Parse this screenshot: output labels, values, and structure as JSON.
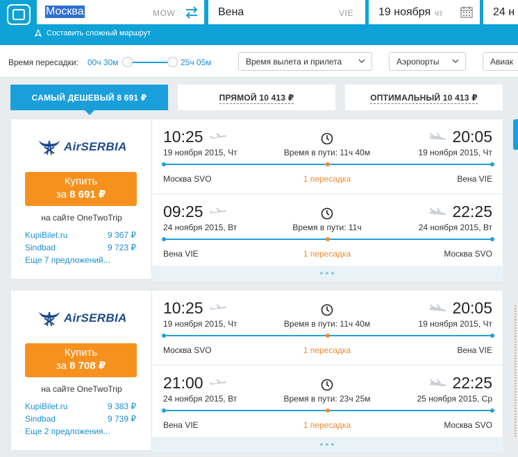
{
  "search": {
    "from_city": "Москва",
    "from_code": "MOW",
    "to_city": "Вена",
    "to_code": "VIE",
    "date_depart": "19 ноября",
    "date_depart_dow": "чт",
    "date_return": "24 н",
    "complex_route_link": "Составить сложный маршрут"
  },
  "filters": {
    "transfer_time_label": "Время пересадки:",
    "transfer_min": "00ч 30м",
    "transfer_max": "25ч 05м",
    "times_dropdown": "Время вылета и прилета",
    "airports_dropdown": "Аэропорты",
    "airlines_dropdown": "Авиак"
  },
  "tabs": [
    {
      "label": "САМЫЙ ДЕШЕВЫЙ",
      "price": "8 691 ₽",
      "active": true
    },
    {
      "label": "ПРЯМОЙ",
      "price": "10 413 ₽",
      "active": false
    },
    {
      "label": "ОПТИМАЛЬНЫЙ",
      "price": "10 413 ₽",
      "active": false
    }
  ],
  "results": [
    {
      "airline": "AirSERBIA",
      "buy_label": "Купить",
      "buy_price_prefix": "за",
      "buy_price": "8 691 ₽",
      "site": "на сайте OneTwoTrip",
      "offers": [
        {
          "name": "KupiBilet.ru",
          "price": "9 367 ₽"
        },
        {
          "name": "Sindbad",
          "price": "9 723 ₽"
        }
      ],
      "more_offers": "Еще 7 предложений...",
      "segments": [
        {
          "dep_time": "10:25",
          "dep_date": "19 ноября 2015, Чт",
          "arr_time": "20:05",
          "arr_date": "19 ноября 2015, Чт",
          "duration": "Время в пути: 11ч 40м",
          "from": "Москва SVO",
          "to": "Вена VIE",
          "transfers": "1 пересадка"
        },
        {
          "dep_time": "09:25",
          "dep_date": "24 ноября 2015, Вт",
          "arr_time": "22:25",
          "arr_date": "24 ноября 2015, Вт",
          "duration": "Время в пути: 11ч",
          "from": "Вена VIE",
          "to": "Москва SVO",
          "transfers": "1 пересадка"
        }
      ]
    },
    {
      "airline": "AirSERBIA",
      "buy_label": "Купить",
      "buy_price_prefix": "за",
      "buy_price": "8 708 ₽",
      "site": "на сайте OneTwoTrip",
      "offers": [
        {
          "name": "KupiBilet.ru",
          "price": "9 383 ₽"
        },
        {
          "name": "Sindbad",
          "price": "9 739 ₽"
        }
      ],
      "more_offers": "Еще 2 предложения...",
      "segments": [
        {
          "dep_time": "10:25",
          "dep_date": "19 ноября 2015, Чт",
          "arr_time": "20:05",
          "arr_date": "19 ноября 2015, Чт",
          "duration": "Время в пути: 11ч 40м",
          "from": "Москва SVO",
          "to": "Вена VIE",
          "transfers": "1 пересадка"
        },
        {
          "dep_time": "21:00",
          "dep_date": "24 ноября 2015, Вт",
          "arr_time": "22:25",
          "arr_date": "25 ноября 2015, Ср",
          "duration": "Время в пути: 23ч 25м",
          "from": "Вена VIE",
          "to": "Москва SVO",
          "transfers": "1 пересадка"
        }
      ]
    }
  ],
  "icons": {
    "swap": "swap-arrows-icon",
    "calendar": "calendar-icon",
    "plane": "airplane-icon",
    "clock": "clock-icon",
    "route": "route-pin-icon",
    "chevron": "chevron-down-icon"
  },
  "colors": {
    "brand_blue": "#0fa2d6",
    "tab_active": "#1a9fdb",
    "buy_orange": "#f7911e",
    "transfer_orange": "#f08a2c",
    "airline_navy": "#1d4a8e"
  }
}
